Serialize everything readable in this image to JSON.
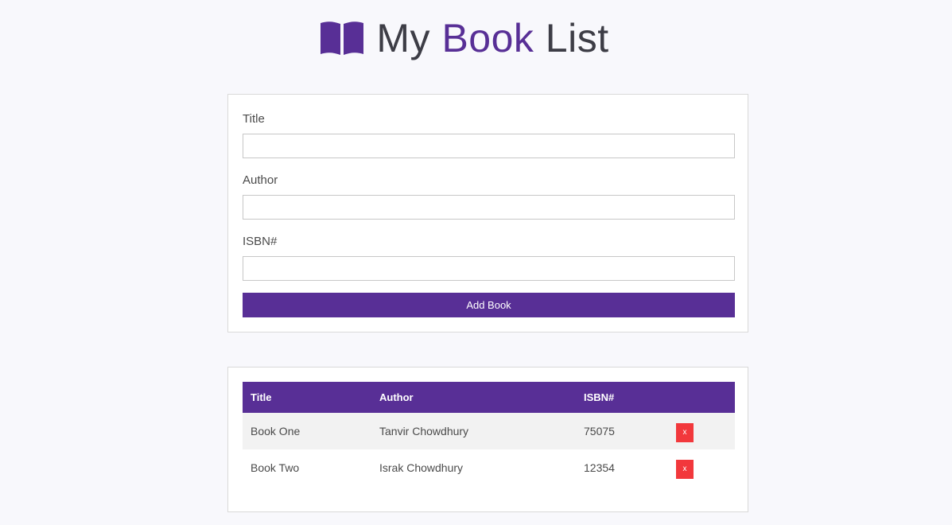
{
  "header": {
    "title_part1": "My ",
    "title_accent": "Book",
    "title_part2": " List",
    "icon": "book-open-icon"
  },
  "form": {
    "fields": [
      {
        "label": "Title",
        "value": "",
        "placeholder": ""
      },
      {
        "label": "Author",
        "value": "",
        "placeholder": ""
      },
      {
        "label": "ISBN#",
        "value": "",
        "placeholder": ""
      }
    ],
    "submit_label": "Add Book"
  },
  "table": {
    "headers": [
      "Title",
      "Author",
      "ISBN#",
      ""
    ],
    "rows": [
      {
        "title": "Book One",
        "author": "Tanvir Chowdhury",
        "isbn": "75075",
        "delete_label": "x"
      },
      {
        "title": "Book Two",
        "author": "Israk Chowdhury",
        "isbn": "12354",
        "delete_label": "x"
      }
    ]
  },
  "colors": {
    "accent": "#582f96",
    "delete": "#f2383c",
    "background": "#f8f8fc"
  }
}
